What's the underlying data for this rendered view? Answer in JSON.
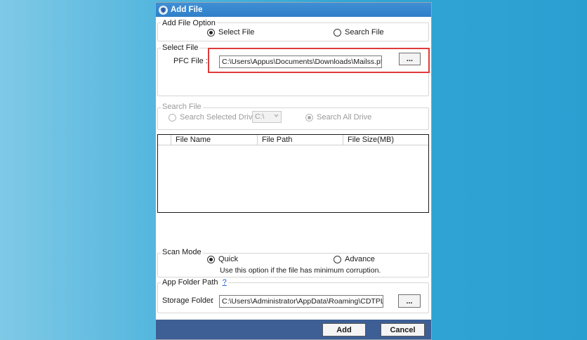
{
  "dialog": {
    "title": "Add File"
  },
  "add_file_option": {
    "label": "Add File Option",
    "select_file": "Select File",
    "search_file": "Search File"
  },
  "select_file": {
    "label": "Select File",
    "pfc_label": "PFC File :",
    "pfc_value": "C:\\Users\\Appus\\Documents\\Downloads\\Mailss.pfc",
    "browse": "..."
  },
  "search_file": {
    "label": "Search File",
    "selected_drive": "Search Selected Drive",
    "drive_value": "C:\\",
    "all_drive": "Search All Drive"
  },
  "grid": {
    "columns": [
      "File Name",
      "File Path",
      "File Size(MB)"
    ]
  },
  "scan_mode": {
    "label": "Scan Mode",
    "quick": "Quick",
    "advance": "Advance",
    "note": "Use this option if the file has minimum corruption."
  },
  "app_folder": {
    "label": "App Folder Path",
    "help": "?",
    "storage_label": "Storage Folder",
    "colon": ":",
    "storage_value": "C:\\Users\\Administrator\\AppData\\Roaming\\CDTPL\\Sys",
    "browse": "..."
  },
  "footer": {
    "add": "Add",
    "cancel": "Cancel"
  },
  "colors": {
    "titlebar": "#2f7fc9",
    "footer": "#3d5f95",
    "highlight": "#e03a3a"
  }
}
